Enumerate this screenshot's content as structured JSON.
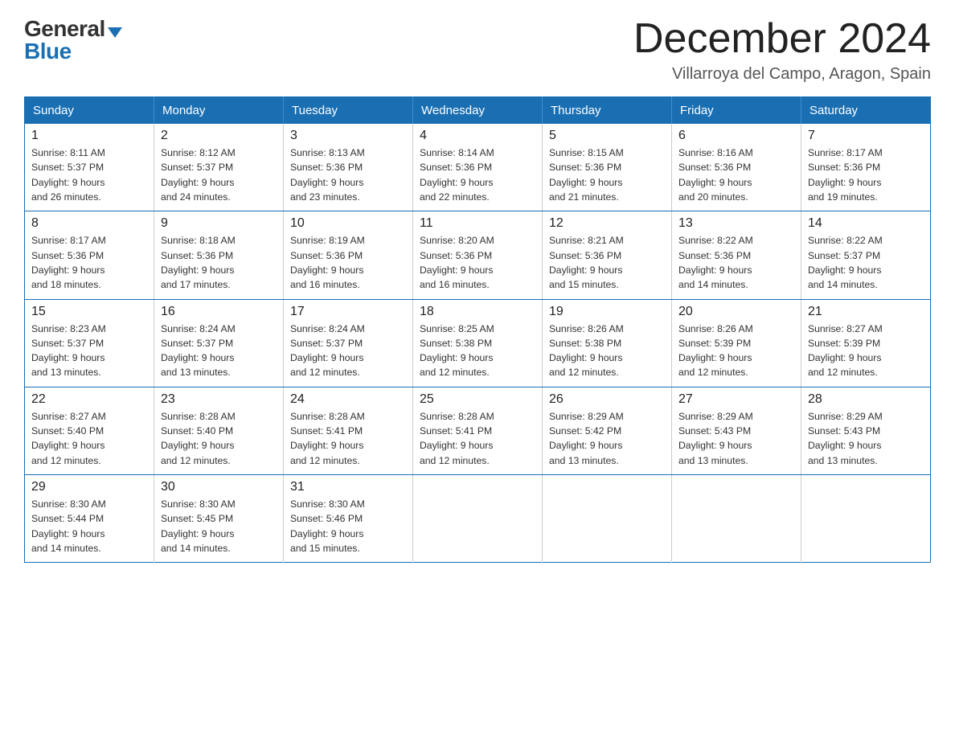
{
  "header": {
    "month_title": "December 2024",
    "subtitle": "Villarroya del Campo, Aragon, Spain",
    "logo_general": "General",
    "logo_blue": "Blue"
  },
  "days_of_week": [
    "Sunday",
    "Monday",
    "Tuesday",
    "Wednesday",
    "Thursday",
    "Friday",
    "Saturday"
  ],
  "weeks": [
    [
      {
        "day": "1",
        "sunrise": "8:11 AM",
        "sunset": "5:37 PM",
        "daylight": "9 hours and 26 minutes."
      },
      {
        "day": "2",
        "sunrise": "8:12 AM",
        "sunset": "5:37 PM",
        "daylight": "9 hours and 24 minutes."
      },
      {
        "day": "3",
        "sunrise": "8:13 AM",
        "sunset": "5:36 PM",
        "daylight": "9 hours and 23 minutes."
      },
      {
        "day": "4",
        "sunrise": "8:14 AM",
        "sunset": "5:36 PM",
        "daylight": "9 hours and 22 minutes."
      },
      {
        "day": "5",
        "sunrise": "8:15 AM",
        "sunset": "5:36 PM",
        "daylight": "9 hours and 21 minutes."
      },
      {
        "day": "6",
        "sunrise": "8:16 AM",
        "sunset": "5:36 PM",
        "daylight": "9 hours and 20 minutes."
      },
      {
        "day": "7",
        "sunrise": "8:17 AM",
        "sunset": "5:36 PM",
        "daylight": "9 hours and 19 minutes."
      }
    ],
    [
      {
        "day": "8",
        "sunrise": "8:17 AM",
        "sunset": "5:36 PM",
        "daylight": "9 hours and 18 minutes."
      },
      {
        "day": "9",
        "sunrise": "8:18 AM",
        "sunset": "5:36 PM",
        "daylight": "9 hours and 17 minutes."
      },
      {
        "day": "10",
        "sunrise": "8:19 AM",
        "sunset": "5:36 PM",
        "daylight": "9 hours and 16 minutes."
      },
      {
        "day": "11",
        "sunrise": "8:20 AM",
        "sunset": "5:36 PM",
        "daylight": "9 hours and 16 minutes."
      },
      {
        "day": "12",
        "sunrise": "8:21 AM",
        "sunset": "5:36 PM",
        "daylight": "9 hours and 15 minutes."
      },
      {
        "day": "13",
        "sunrise": "8:22 AM",
        "sunset": "5:36 PM",
        "daylight": "9 hours and 14 minutes."
      },
      {
        "day": "14",
        "sunrise": "8:22 AM",
        "sunset": "5:37 PM",
        "daylight": "9 hours and 14 minutes."
      }
    ],
    [
      {
        "day": "15",
        "sunrise": "8:23 AM",
        "sunset": "5:37 PM",
        "daylight": "9 hours and 13 minutes."
      },
      {
        "day": "16",
        "sunrise": "8:24 AM",
        "sunset": "5:37 PM",
        "daylight": "9 hours and 13 minutes."
      },
      {
        "day": "17",
        "sunrise": "8:24 AM",
        "sunset": "5:37 PM",
        "daylight": "9 hours and 12 minutes."
      },
      {
        "day": "18",
        "sunrise": "8:25 AM",
        "sunset": "5:38 PM",
        "daylight": "9 hours and 12 minutes."
      },
      {
        "day": "19",
        "sunrise": "8:26 AM",
        "sunset": "5:38 PM",
        "daylight": "9 hours and 12 minutes."
      },
      {
        "day": "20",
        "sunrise": "8:26 AM",
        "sunset": "5:39 PM",
        "daylight": "9 hours and 12 minutes."
      },
      {
        "day": "21",
        "sunrise": "8:27 AM",
        "sunset": "5:39 PM",
        "daylight": "9 hours and 12 minutes."
      }
    ],
    [
      {
        "day": "22",
        "sunrise": "8:27 AM",
        "sunset": "5:40 PM",
        "daylight": "9 hours and 12 minutes."
      },
      {
        "day": "23",
        "sunrise": "8:28 AM",
        "sunset": "5:40 PM",
        "daylight": "9 hours and 12 minutes."
      },
      {
        "day": "24",
        "sunrise": "8:28 AM",
        "sunset": "5:41 PM",
        "daylight": "9 hours and 12 minutes."
      },
      {
        "day": "25",
        "sunrise": "8:28 AM",
        "sunset": "5:41 PM",
        "daylight": "9 hours and 12 minutes."
      },
      {
        "day": "26",
        "sunrise": "8:29 AM",
        "sunset": "5:42 PM",
        "daylight": "9 hours and 13 minutes."
      },
      {
        "day": "27",
        "sunrise": "8:29 AM",
        "sunset": "5:43 PM",
        "daylight": "9 hours and 13 minutes."
      },
      {
        "day": "28",
        "sunrise": "8:29 AM",
        "sunset": "5:43 PM",
        "daylight": "9 hours and 13 minutes."
      }
    ],
    [
      {
        "day": "29",
        "sunrise": "8:30 AM",
        "sunset": "5:44 PM",
        "daylight": "9 hours and 14 minutes."
      },
      {
        "day": "30",
        "sunrise": "8:30 AM",
        "sunset": "5:45 PM",
        "daylight": "9 hours and 14 minutes."
      },
      {
        "day": "31",
        "sunrise": "8:30 AM",
        "sunset": "5:46 PM",
        "daylight": "9 hours and 15 minutes."
      },
      null,
      null,
      null,
      null
    ]
  ],
  "labels": {
    "sunrise": "Sunrise:",
    "sunset": "Sunset:",
    "daylight": "Daylight:"
  }
}
